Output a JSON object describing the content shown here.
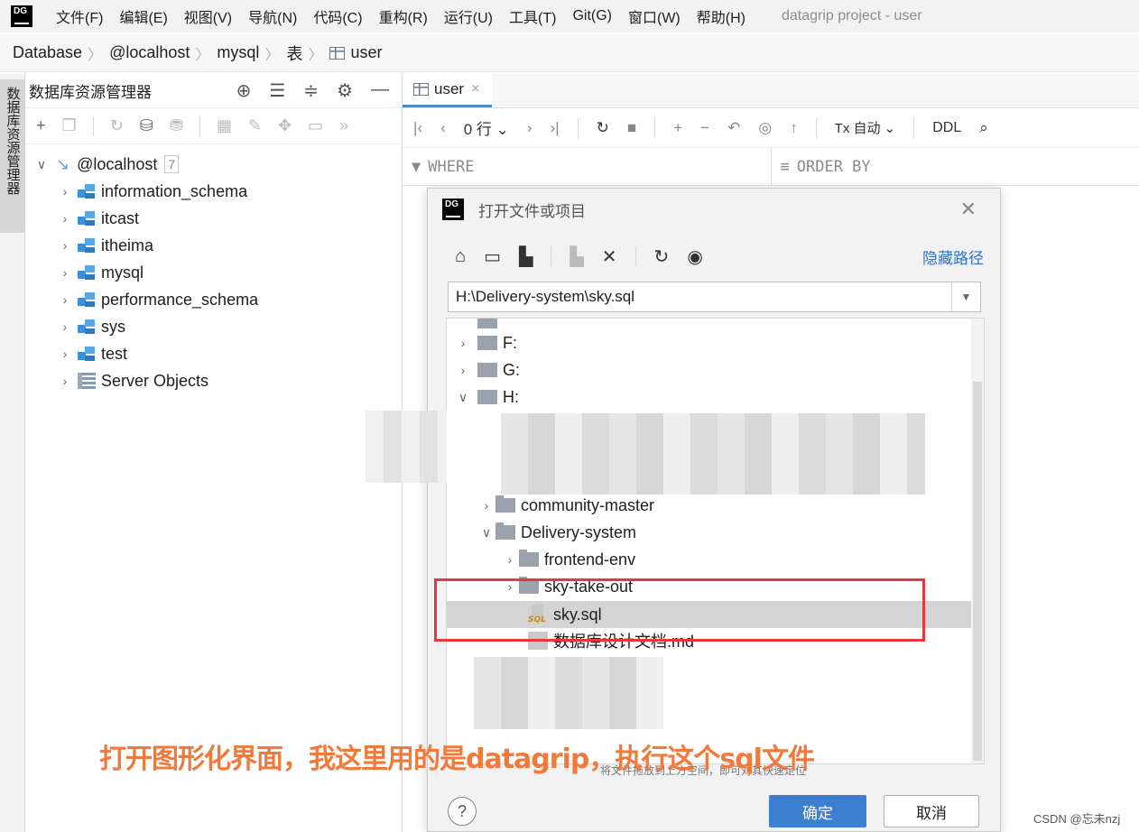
{
  "menubar": {
    "logo": "DG",
    "items": [
      "文件(F)",
      "编辑(E)",
      "视图(V)",
      "导航(N)",
      "代码(C)",
      "重构(R)",
      "运行(U)",
      "工具(T)",
      "Git(G)",
      "窗口(W)",
      "帮助(H)"
    ],
    "window_title": "datagrip project - user"
  },
  "breadcrumb": [
    "Database",
    "@localhost",
    "mysql",
    "表",
    "user"
  ],
  "sidebar": {
    "tab_label": "数据库资源管理器"
  },
  "explorer": {
    "title": "数据库资源管理器",
    "root": {
      "label": "@localhost",
      "badge": "7"
    },
    "schemas": [
      "information_schema",
      "itcast",
      "itheima",
      "mysql",
      "performance_schema",
      "sys",
      "test"
    ],
    "server_objects": "Server Objects"
  },
  "editor": {
    "tab_label": "user",
    "rows_label": "0 行",
    "tx_label": "Tx 自动",
    "ddl_label": "DDL",
    "where_label": "WHERE",
    "orderby_label": "ORDER BY"
  },
  "dialog": {
    "logo": "DG",
    "title": "打开文件或项目",
    "hide_path": "隐藏路径",
    "path_value": "H:\\Delivery-system\\sky.sql",
    "tree": {
      "drive_f": "F:",
      "drive_g": "G:",
      "drive_h": "H:",
      "community": "community-master",
      "delivery": "Delivery-system",
      "frontend": "frontend-env",
      "skytakeout": "sky-take-out",
      "skysql": "sky.sql",
      "doc": "数据库设计文档.md"
    },
    "drop_hint": "将文件拖放到上方空间，即可对其快速定位",
    "ok": "确定",
    "cancel": "取消",
    "help": "?"
  },
  "annotation": "打开图形化界面，我这里用的是datagrip，执行这个sql文件",
  "watermark": "CSDN @忘未nzj",
  "colors": {
    "accent": "#3c7fd1",
    "annotation": "#f07a3c",
    "highlight_box": "#e8383d"
  }
}
